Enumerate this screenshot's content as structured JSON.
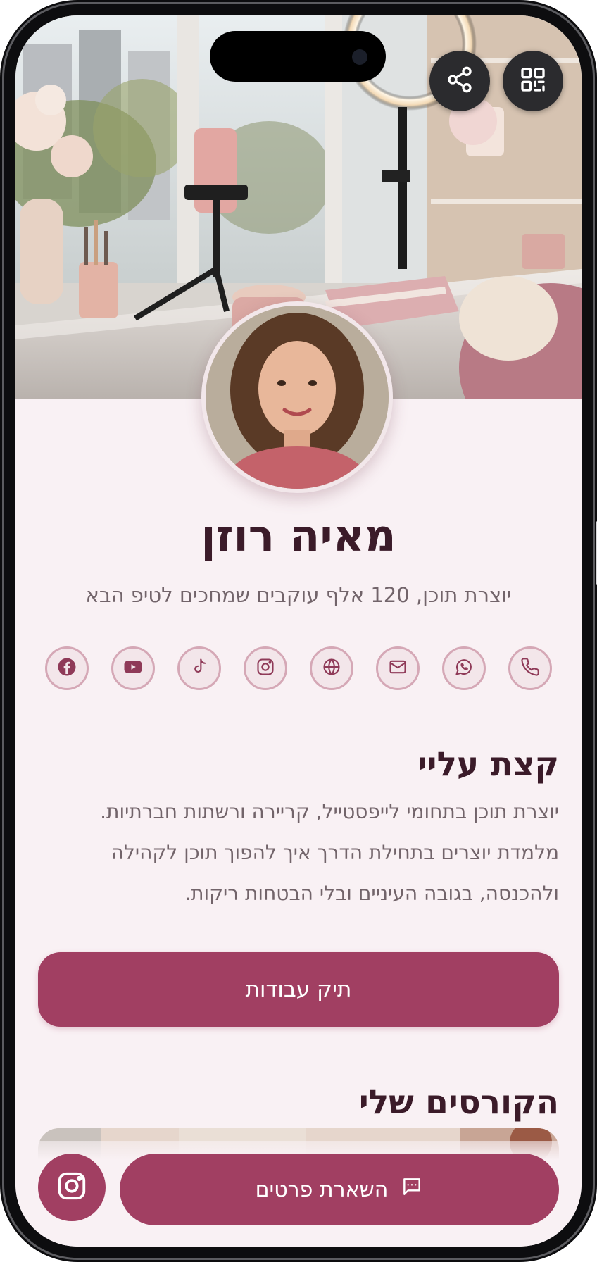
{
  "profile": {
    "name": "מאיה רוזן",
    "tagline": "יוצרת תוכן, 120 אלף עוקבים שמחכים לטיפ הבא"
  },
  "header": {
    "share_icon": "share-icon",
    "qr_icon": "qr-code-icon"
  },
  "socials": [
    {
      "icon": "phone-icon"
    },
    {
      "icon": "whatsapp-icon"
    },
    {
      "icon": "mail-icon"
    },
    {
      "icon": "globe-icon"
    },
    {
      "icon": "instagram-icon"
    },
    {
      "icon": "tiktok-icon"
    },
    {
      "icon": "youtube-icon"
    },
    {
      "icon": "facebook-icon"
    }
  ],
  "about": {
    "heading": "קצת עליי",
    "text": "יוצרת תוכן בתחומי לייפסטייל, קריירה ורשתות חברתיות. מלמדת יוצרים בתחילת הדרך איך להפוך תוכן לקהילה ולהכנסה, בגובה העיניים ובלי הבטחות ריקות."
  },
  "portfolio_button": "תיק עבודות",
  "courses": {
    "heading": "הקורסים שלי"
  },
  "footer": {
    "leave_details": "השארת פרטים",
    "chat_icon": "chat-icon",
    "instagram_icon": "instagram-icon"
  },
  "colors": {
    "accent": "#a13f62",
    "background": "#f9f1f4",
    "heading": "#3b1b29",
    "body_text": "#72646a",
    "icon_border": "#d5a8b6"
  }
}
